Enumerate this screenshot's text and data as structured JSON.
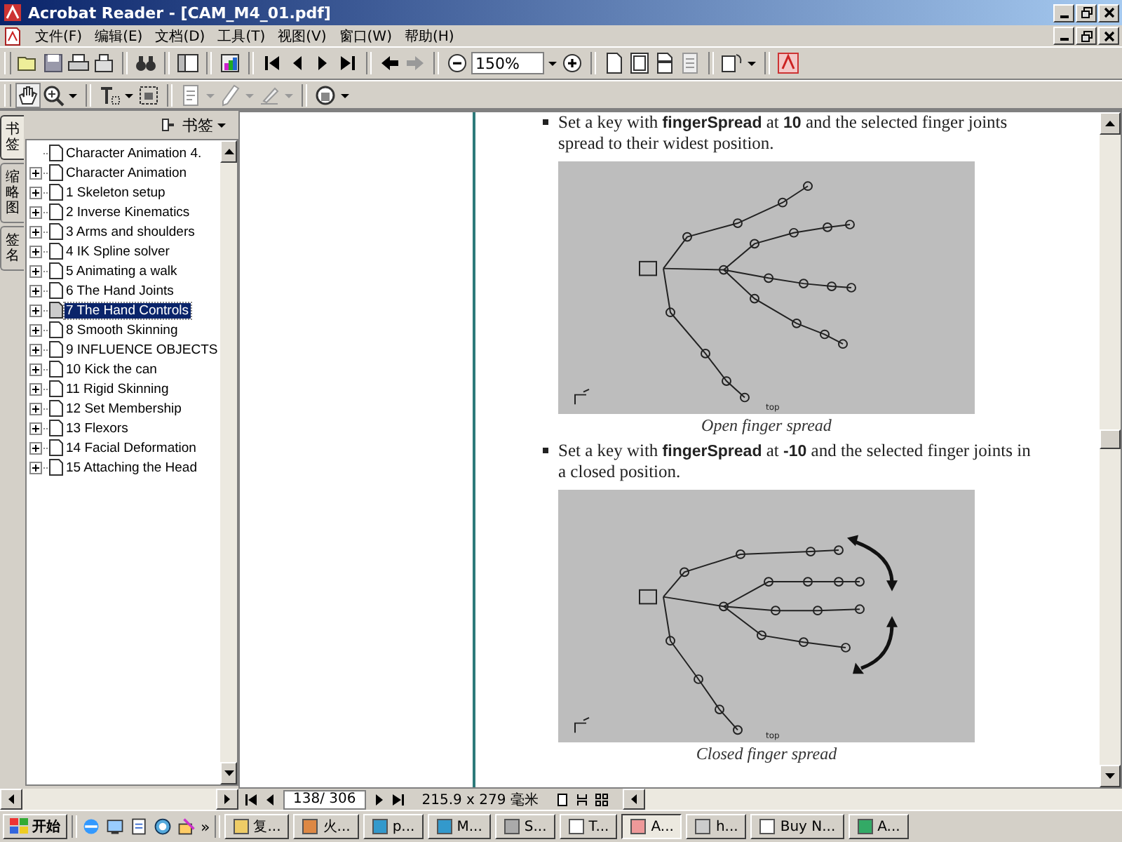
{
  "window": {
    "title": "Acrobat Reader - [CAM_M4_01.pdf]"
  },
  "menu": [
    "文件(F)",
    "编辑(E)",
    "文档(D)",
    "工具(T)",
    "视图(V)",
    "窗口(W)",
    "帮助(H)"
  ],
  "toolbar": {
    "zoom": "150%"
  },
  "nav_panel": {
    "header": "书签",
    "tabs": [
      {
        "label": "书签",
        "selected": true
      },
      {
        "label": "缩略图",
        "selected": false
      },
      {
        "label": "签名",
        "selected": false
      }
    ],
    "items": [
      {
        "label": "Character Animation 4.",
        "kind": "leaf",
        "selected": false
      },
      {
        "label": "Character Animation",
        "kind": "branch",
        "expanded": false,
        "selected": false
      },
      {
        "label": "1 Skeleton setup",
        "kind": "branch",
        "expanded": false,
        "selected": false
      },
      {
        "label": "2 Inverse Kinematics",
        "kind": "branch",
        "expanded": false,
        "selected": false
      },
      {
        "label": "3 Arms and shoulders",
        "kind": "branch",
        "expanded": false,
        "selected": false
      },
      {
        "label": "4 IK Spline solver",
        "kind": "branch",
        "expanded": false,
        "selected": false
      },
      {
        "label": "5 Animating a walk",
        "kind": "branch",
        "expanded": false,
        "selected": false
      },
      {
        "label": "6 The Hand Joints",
        "kind": "branch",
        "expanded": false,
        "selected": false
      },
      {
        "label": "7 The Hand Controls",
        "kind": "branch",
        "expanded": false,
        "selected": true
      },
      {
        "label": "8 Smooth Skinning",
        "kind": "branch",
        "expanded": false,
        "selected": false
      },
      {
        "label": "9 INFLUENCE OBJECTS",
        "kind": "branch",
        "expanded": false,
        "selected": false
      },
      {
        "label": "10 Kick the can",
        "kind": "branch",
        "expanded": false,
        "selected": false
      },
      {
        "label": "11 Rigid Skinning",
        "kind": "branch",
        "expanded": false,
        "selected": false
      },
      {
        "label": "12 Set Membership",
        "kind": "branch",
        "expanded": false,
        "selected": false
      },
      {
        "label": "13 Flexors",
        "kind": "branch",
        "expanded": false,
        "selected": false
      },
      {
        "label": "14 Facial Deformation",
        "kind": "branch",
        "expanded": false,
        "selected": false
      },
      {
        "label": "15 Attaching the Head",
        "kind": "branch",
        "expanded": false,
        "selected": false
      }
    ]
  },
  "document": {
    "blocks": [
      {
        "kind": "bullet",
        "text": "Set a key with **fingerSpread** at **10** and the selected finger joints spread to their widest position."
      },
      {
        "kind": "figure",
        "arrows": false,
        "view_label": "top",
        "caption": "Open finger spread"
      },
      {
        "kind": "bullet",
        "text": "Set a key with **fingerSpread** at **-10** and the selected finger joints in a closed position."
      },
      {
        "kind": "figure",
        "arrows": true,
        "view_label": "top",
        "caption": "Closed finger spread"
      }
    ]
  },
  "status_bar": {
    "page": "138/ 306",
    "page_size": "215.9 x 279 毫米"
  },
  "taskbar": {
    "start": "开始",
    "more": "»",
    "tasks": [
      {
        "label": "复...",
        "selected": false
      },
      {
        "label": "火...",
        "selected": false
      },
      {
        "label": "p...",
        "selected": false
      },
      {
        "label": "M...",
        "selected": false
      },
      {
        "label": "S...",
        "selected": false
      },
      {
        "label": "T...",
        "selected": false
      },
      {
        "label": "A...",
        "selected": true
      },
      {
        "label": "h...",
        "selected": false
      },
      {
        "label": "Buy N...",
        "selected": false
      },
      {
        "label": "A...",
        "selected": false
      }
    ]
  }
}
